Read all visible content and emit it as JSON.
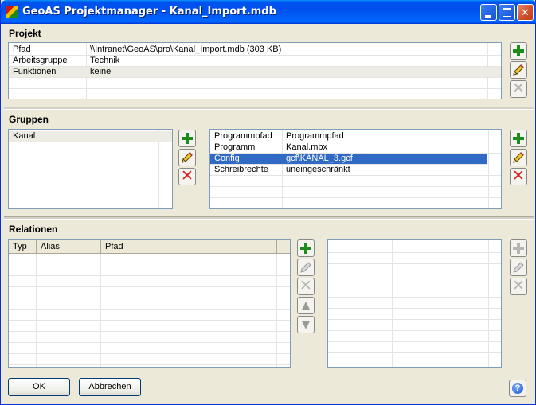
{
  "window": {
    "title": "GeoAS Projektmanager - Kanal_Import.mdb",
    "title_color": "#0053ee"
  },
  "projekt": {
    "heading": "Projekt",
    "rows": [
      {
        "key": "Pfad",
        "value": "\\\\Intranet\\GeoAS\\pro\\Kanal_Import.mdb     (303 KB)"
      },
      {
        "key": "Arbeitsgruppe",
        "value": "Technik"
      },
      {
        "key": "Funktionen",
        "value": "keine"
      }
    ]
  },
  "gruppen": {
    "heading": "Gruppen",
    "list": [
      "Kanal"
    ],
    "properties": [
      {
        "key": "Programmpfad",
        "value": "Programmpfad"
      },
      {
        "key": "Programm",
        "value": "Kanal.mbx"
      },
      {
        "key": "Config",
        "value": "gcf\\KANAL_3.gcf"
      },
      {
        "key": "Schreibrechte",
        "value": "uneingeschränkt"
      }
    ],
    "selected_color": "#316ac5"
  },
  "relationen": {
    "heading": "Relationen",
    "columns": [
      "Typ",
      "Alias",
      "Pfad"
    ]
  },
  "buttons": {
    "ok": "OK",
    "cancel": "Abbrechen",
    "help": "?"
  },
  "icons": {
    "add": "plus-icon",
    "edit": "pencil-icon",
    "delete": "delete-x-icon",
    "up": "arrow-up-icon",
    "down": "arrow-down-icon",
    "help": "help-icon"
  }
}
